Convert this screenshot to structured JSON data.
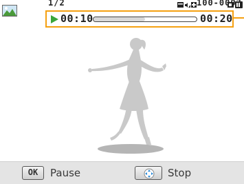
{
  "header": {
    "file_counter": "1/2",
    "folder_file": "100-0002",
    "icons": [
      "photo-thumbnail-icon",
      "memory-card-icon",
      "volume-icon",
      "flash-icon",
      "battery-icon"
    ]
  },
  "playback": {
    "state_icon": "play-icon",
    "elapsed": "00:10",
    "total": "00:20",
    "progress_fraction": 0.5
  },
  "footer": {
    "ok_key": "OK",
    "pause_label": "Pause",
    "nav_key_icon": "dpad-icon",
    "stop_label": "Stop"
  },
  "colors": {
    "highlight": "#f5a010",
    "play": "#3aa63a",
    "silhouette": "#c9c9c9"
  }
}
